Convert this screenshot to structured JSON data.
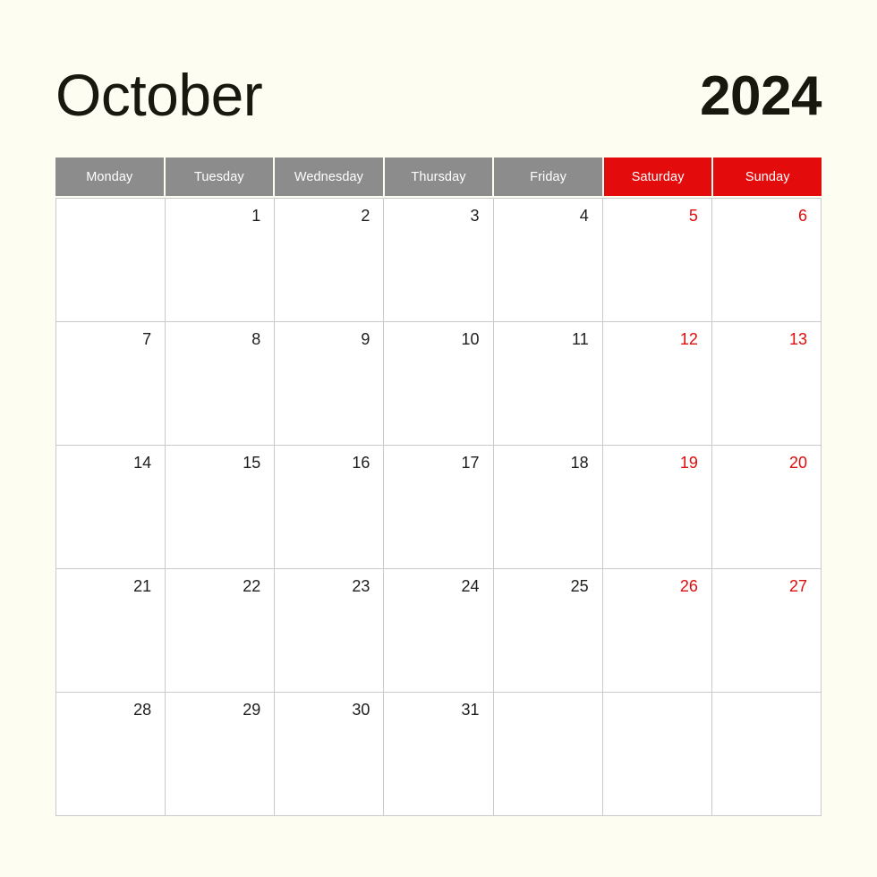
{
  "header": {
    "month": "October",
    "year": "2024"
  },
  "colors": {
    "background": "#FDFDF2",
    "weekday_bar": "#8C8C8C",
    "weekend_accent": "#E30B0B",
    "grid_line": "#C9C9C9",
    "cell_background": "#FFFFFF",
    "text": "#1D1D1B"
  },
  "weekdays": [
    {
      "label": "Monday",
      "weekend": false
    },
    {
      "label": "Tuesday",
      "weekend": false
    },
    {
      "label": "Wednesday",
      "weekend": false
    },
    {
      "label": "Thursday",
      "weekend": false
    },
    {
      "label": "Friday",
      "weekend": false
    },
    {
      "label": "Saturday",
      "weekend": true
    },
    {
      "label": "Sunday",
      "weekend": true
    }
  ],
  "weeks": [
    [
      {
        "day": "",
        "weekend": false
      },
      {
        "day": "1",
        "weekend": false
      },
      {
        "day": "2",
        "weekend": false
      },
      {
        "day": "3",
        "weekend": false
      },
      {
        "day": "4",
        "weekend": false
      },
      {
        "day": "5",
        "weekend": true
      },
      {
        "day": "6",
        "weekend": true
      }
    ],
    [
      {
        "day": "7",
        "weekend": false
      },
      {
        "day": "8",
        "weekend": false
      },
      {
        "day": "9",
        "weekend": false
      },
      {
        "day": "10",
        "weekend": false
      },
      {
        "day": "11",
        "weekend": false
      },
      {
        "day": "12",
        "weekend": true
      },
      {
        "day": "13",
        "weekend": true
      }
    ],
    [
      {
        "day": "14",
        "weekend": false
      },
      {
        "day": "15",
        "weekend": false
      },
      {
        "day": "16",
        "weekend": false
      },
      {
        "day": "17",
        "weekend": false
      },
      {
        "day": "18",
        "weekend": false
      },
      {
        "day": "19",
        "weekend": true
      },
      {
        "day": "20",
        "weekend": true
      }
    ],
    [
      {
        "day": "21",
        "weekend": false
      },
      {
        "day": "22",
        "weekend": false
      },
      {
        "day": "23",
        "weekend": false
      },
      {
        "day": "24",
        "weekend": false
      },
      {
        "day": "25",
        "weekend": false
      },
      {
        "day": "26",
        "weekend": true
      },
      {
        "day": "27",
        "weekend": true
      }
    ],
    [
      {
        "day": "28",
        "weekend": false
      },
      {
        "day": "29",
        "weekend": false
      },
      {
        "day": "30",
        "weekend": false
      },
      {
        "day": "31",
        "weekend": false
      },
      {
        "day": "",
        "weekend": false
      },
      {
        "day": "",
        "weekend": true
      },
      {
        "day": "",
        "weekend": true
      }
    ]
  ]
}
